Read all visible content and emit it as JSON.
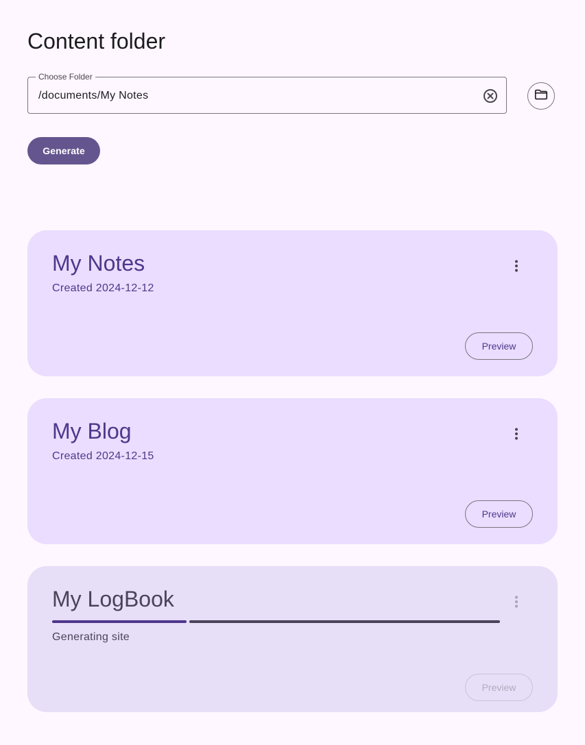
{
  "header": {
    "title": "Content folder"
  },
  "folder_picker": {
    "label": "Choose Folder",
    "value": "/documents/My Notes",
    "clear_icon": "clear-circle-icon",
    "browse_icon": "folder-icon"
  },
  "actions": {
    "generate_label": "Generate"
  },
  "colors": {
    "background": "#fef7ff",
    "primary": "#65558f",
    "card": "#eaddff",
    "card_disabled": "#e7def8",
    "accent_text": "#4f378a"
  },
  "sites": [
    {
      "title": "My Notes",
      "subtitle": "Created 2024-12-12",
      "preview_label": "Preview",
      "menu_icon": "more-vert-icon",
      "state": "ready"
    },
    {
      "title": "My Blog",
      "subtitle": "Created 2024-12-15",
      "preview_label": "Preview",
      "menu_icon": "more-vert-icon",
      "state": "ready"
    },
    {
      "title": "My LogBook",
      "subtitle": "Generating site",
      "preview_label": "Preview",
      "menu_icon": "more-vert-icon",
      "state": "generating",
      "progress": 0.3
    }
  ]
}
